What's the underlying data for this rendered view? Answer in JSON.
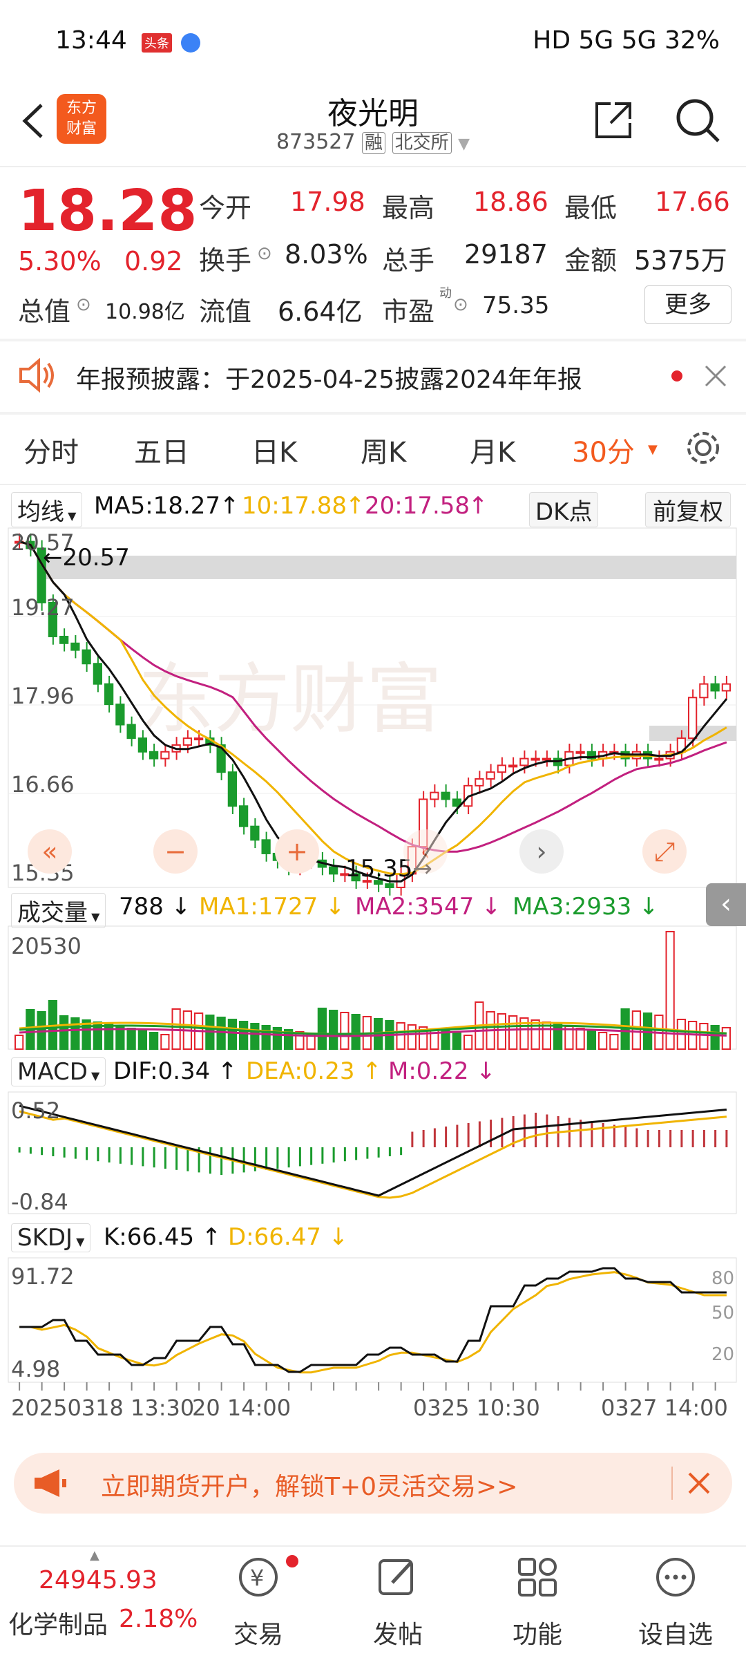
{
  "status_bar": {
    "time": "13:44",
    "badge": "头条",
    "right": "HD 5G 5G 32%"
  },
  "header": {
    "logo_line1": "东方",
    "logo_line2": "财富",
    "title": "夜光明",
    "code": "873527",
    "tag1": "融",
    "tag2": "北交所"
  },
  "quote": {
    "price": "18.28",
    "change_pct": "5.30%",
    "change": "0.92",
    "open_label": "今开",
    "open": "17.98",
    "high_label": "最高",
    "high": "18.86",
    "low_label": "最低",
    "low": "17.66",
    "turnover_label": "换手",
    "turnover": "8.03%",
    "volume_label": "总手",
    "volume": "29187",
    "amount_label": "金额",
    "amount": "5375万",
    "mcap_label": "总值",
    "mcap": "10.98亿",
    "float_label": "流值",
    "float": "6.64亿",
    "pe_label": "市盈",
    "pe_sup": "动",
    "pe": "75.35",
    "more": "更多"
  },
  "notice": {
    "text": "年报预披露：于2025-04-25披露2024年年报"
  },
  "tabs": [
    "分时",
    "五日",
    "日K",
    "周K",
    "月K",
    "30分"
  ],
  "active_tab": 5,
  "kline": {
    "selector": "均线",
    "ma5": "MA5:18.27",
    "ma10": "10:17.88",
    "ma20": "20:17.58",
    "dk": "DK点",
    "adjust": "前复权",
    "y_labels": [
      "20.57",
      "19.27",
      "17.96",
      "16.66",
      "15.35"
    ],
    "max_label": "20.57",
    "min_label": "15.35"
  },
  "volume": {
    "selector": "成交量",
    "value": "788",
    "ma1": "MA1:1727",
    "ma2": "MA2:3547",
    "ma3": "MA3:2933",
    "y_label": "20530"
  },
  "macd": {
    "selector": "MACD",
    "dif": "DIF:0.34",
    "dea": "DEA:0.23",
    "m": "M:0.22",
    "y_top": "0.52",
    "y_bottom": "-0.84"
  },
  "skdj": {
    "selector": "SKDJ",
    "k": "K:66.45",
    "d": "D:66.47",
    "y_top": "91.72",
    "y_bottom": "4.98",
    "levels": [
      "80",
      "50",
      "20"
    ]
  },
  "time_axis": [
    "20250318 13:30",
    "20 14:00",
    "0325 10:30",
    "0327 14:00"
  ],
  "promo": {
    "text": "立即期货开户，解锁T+0灵活交易>>"
  },
  "bottom_bar": {
    "index_value": "24945.93",
    "index_name": "化学制品",
    "index_change": "2.18%",
    "items": [
      "交易",
      "发帖",
      "功能",
      "设自选"
    ]
  },
  "colors": {
    "up": "#e3232c",
    "down": "#1a9b2d",
    "ma5": "#111111",
    "ma10": "#f0b400",
    "ma20": "#c2207f",
    "accent": "#f35a1e"
  }
}
